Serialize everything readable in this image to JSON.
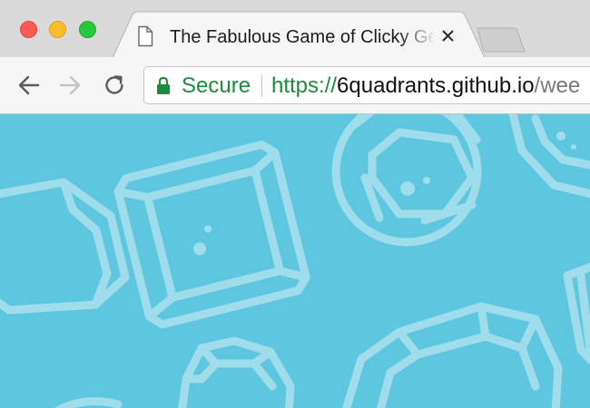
{
  "window": {
    "traffic_lights": [
      "close",
      "minimize",
      "maximize"
    ]
  },
  "tab": {
    "title": "The Fabulous Game of Clicky Gems",
    "icon": "document-icon",
    "close_glyph": "✕"
  },
  "toolbar": {
    "back_icon": "arrow-left-icon",
    "forward_icon": "arrow-right-icon",
    "reload_icon": "reload-icon"
  },
  "address_bar": {
    "security_label": "Secure",
    "url_scheme": "https://",
    "url_host": "6quadrants.github.io",
    "url_path": "/wee"
  },
  "colors": {
    "page_background": "#5fc6e0",
    "gem_outline": "#9fdcec",
    "secure_green": "#1e8c3e"
  },
  "page": {
    "background_pattern": "gem-outlines"
  }
}
